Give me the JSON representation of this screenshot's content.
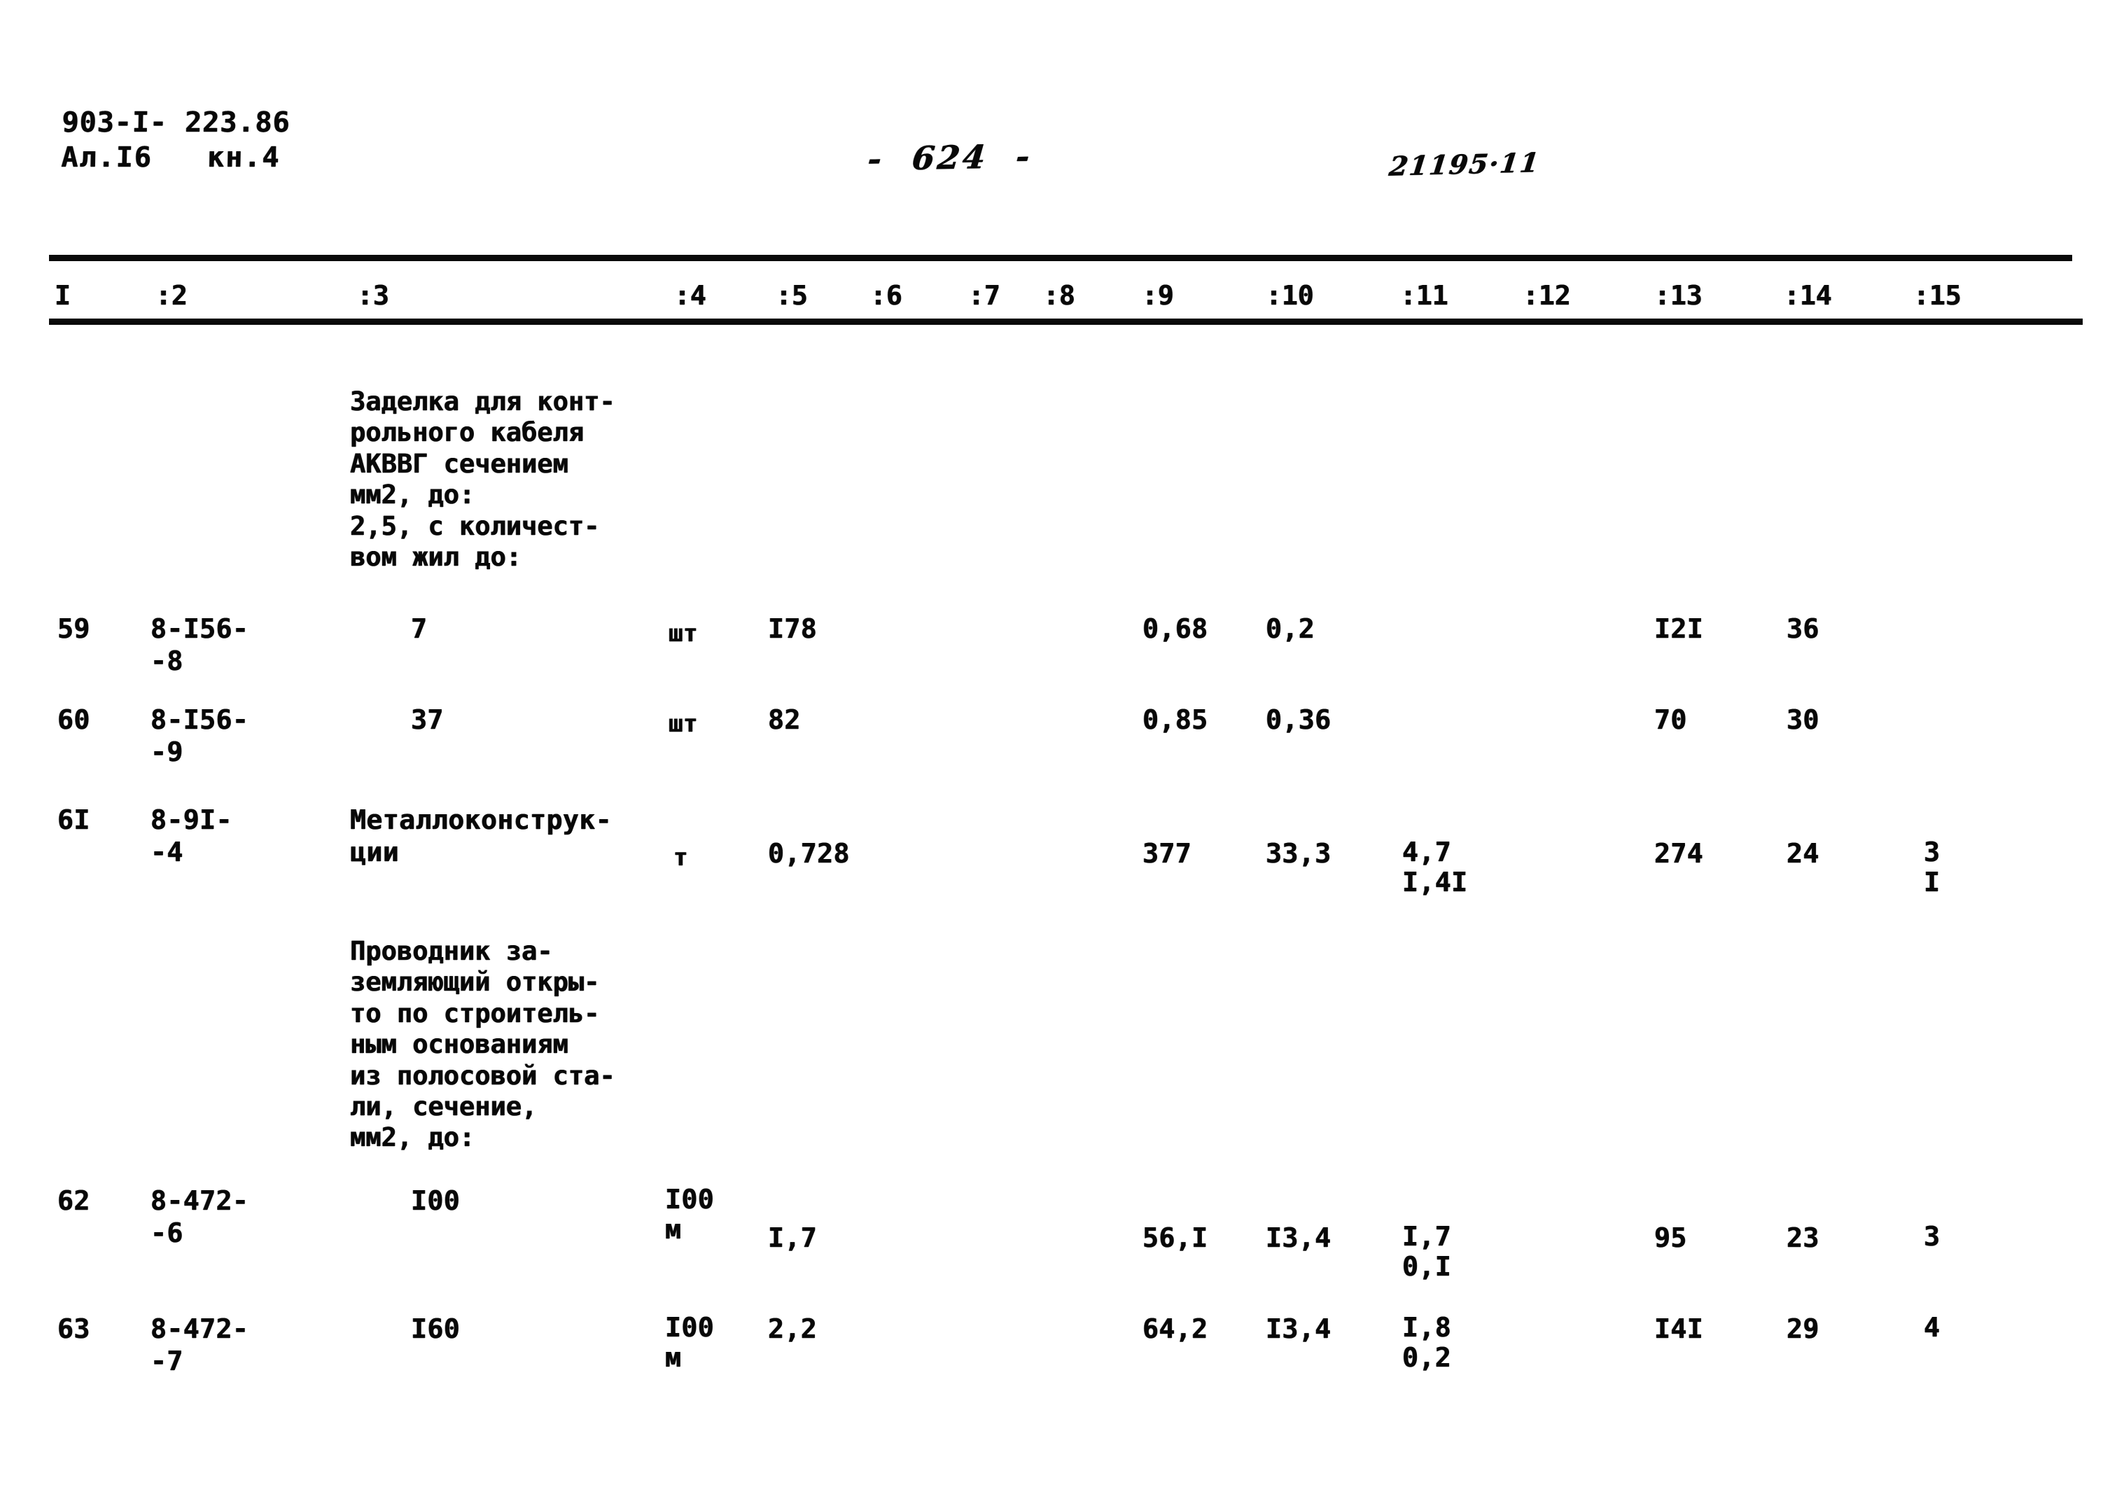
{
  "header": {
    "doc_code_line1": "903-I- 223.86",
    "doc_code_line2": "Ал.I6   кн.4",
    "page_number": "-  624  -",
    "stamp_number": "21195·11"
  },
  "table": {
    "column_headers": [
      "I",
      ":2",
      ":3",
      ":4",
      ":5",
      ":6",
      ":7",
      ":8",
      ":9",
      ":10",
      ":11",
      ":12",
      ":13",
      ":14",
      ":15"
    ],
    "section_1_title": "Заделка для конт-\nрольного кабеля\nАКВВГ сечением\nмм2, до:\n2,5, с количест-\nвом жил до:",
    "section_2_title": "Проводник за-\nземляющий откры-\nто по строитель-\nным основаниям\nиз полосовой ста-\nли, сечение,\nмм2, до:",
    "rows": [
      {
        "num": "59",
        "code": "8-I56-\n-8",
        "name": "7",
        "unit": "шт",
        "qty": "I78",
        "c9": "0,68",
        "c10": "0,2",
        "c11": "",
        "c12": "",
        "c13": "I2I",
        "c14": "36",
        "c15": ""
      },
      {
        "num": "60",
        "code": "8-I56-\n-9",
        "name": "37",
        "unit": "шт",
        "qty": "82",
        "c9": "0,85",
        "c10": "0,36",
        "c11": "",
        "c12": "",
        "c13": "70",
        "c14": "30",
        "c15": ""
      },
      {
        "num": "6I",
        "code": "8-9I-\n-4",
        "name": "Металлоконструк-\nции",
        "unit": "т",
        "qty": "0,728",
        "c9": "377",
        "c10": "33,3",
        "c11": "4,7\nI,4I",
        "c12": "",
        "c13": "274",
        "c14": "24",
        "c15": "3\nI"
      },
      {
        "num": "62",
        "code": "8-472-\n-6",
        "name": "I00",
        "unit": "I00\nм",
        "qty": "I,7",
        "c9": "56,I",
        "c10": "I3,4",
        "c11": "I,7\n0,I",
        "c12": "",
        "c13": "95",
        "c14": "23",
        "c15": "3"
      },
      {
        "num": "63",
        "code": "8-472-\n-7",
        "name": "I60",
        "unit": "I00\nм",
        "qty": "2,2",
        "c9": "64,2",
        "c10": "I3,4",
        "c11": "I,8\n0,2",
        "c12": "",
        "c13": "I4I",
        "c14": "29",
        "c15": "4"
      }
    ]
  }
}
